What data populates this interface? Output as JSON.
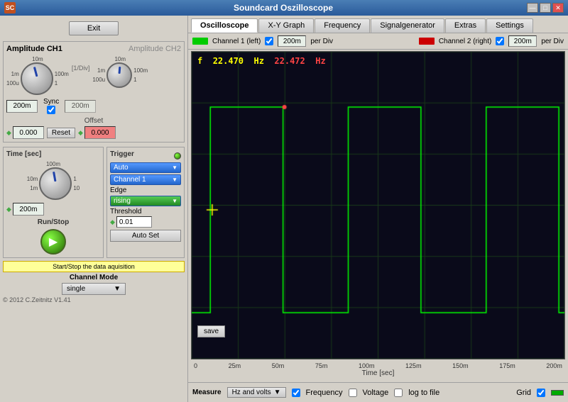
{
  "window": {
    "title": "Soundcard Oszilloscope",
    "minimize_btn": "—",
    "maximize_btn": "□",
    "close_btn": "✕"
  },
  "left": {
    "exit_btn": "Exit",
    "amplitude": {
      "ch1_label": "Amplitude CH1",
      "ch2_label": "Amplitude CH2",
      "div_label": "[1/Div]",
      "ch1_scale_top": "10m",
      "ch1_scale_mid": "1m",
      "ch1_scale_bot": "100u",
      "ch1_inner_top": "100m",
      "ch1_inner_bot": "1",
      "ch2_scale_top": "10m",
      "ch2_scale_mid": "1m",
      "ch2_scale_bot": "100u",
      "ch2_inner_top": "100m",
      "ch2_inner_bot": "1",
      "ch1_input_val": "200m",
      "ch2_input_val": "200m",
      "sync_label": "Sync",
      "offset_label": "Offset",
      "offset_ch1_val": "0.000",
      "offset_ch2_val": "0.000",
      "reset_btn": "Reset"
    },
    "time": {
      "section_label": "Time [sec]",
      "scale_top": "100m",
      "scale_mid_left": "10m",
      "scale_mid_right": "1",
      "scale_bot_left": "1m",
      "scale_bot_right": "10",
      "input_val": "200m"
    },
    "trigger": {
      "section_label": "Trigger",
      "mode_label": "Auto",
      "channel_label": "Channel 1",
      "edge_section_label": "Edge",
      "edge_label": "rising",
      "threshold_label": "Threshold",
      "threshold_val": "0.01",
      "autoset_btn": "Auto Set"
    },
    "run_stop": {
      "section_label": "Run/Stop"
    },
    "start_stop_hint": "Start/Stop the data aquisition",
    "channel_mode": {
      "label": "Channel Mode",
      "value": "single"
    },
    "copyright": "© 2012  C.Zeitnitz V1.41"
  },
  "right": {
    "tabs": [
      {
        "label": "Oscilloscope",
        "active": true
      },
      {
        "label": "X-Y Graph",
        "active": false
      },
      {
        "label": "Frequency",
        "active": false
      },
      {
        "label": "Signalgenerator",
        "active": false
      },
      {
        "label": "Extras",
        "active": false
      },
      {
        "label": "Settings",
        "active": false
      }
    ],
    "controls": {
      "ch1_label": "Channel 1 (left)",
      "ch1_per_div_val": "200m",
      "ch1_per_div_label": "per Div",
      "ch2_label": "Channel 2 (right)",
      "ch2_per_div_val": "200m",
      "ch2_per_div_label": "per Div"
    },
    "display": {
      "freq_prefix": "f",
      "freq_ch1": "22.470",
      "freq_unit1": "Hz",
      "freq_ch2": "22.472",
      "freq_unit2": "Hz"
    },
    "save_btn": "save",
    "x_axis": {
      "labels": [
        "0",
        "25m",
        "50m",
        "75m",
        "100m",
        "125m",
        "150m",
        "175m",
        "200m"
      ],
      "title": "Time [sec]"
    },
    "bottom": {
      "measure_label": "Measure",
      "measure_select": "Hz and volts",
      "frequency_label": "Frequency",
      "voltage_label": "Voltage",
      "log_label": "log to file",
      "grid_label": "Grid"
    }
  }
}
